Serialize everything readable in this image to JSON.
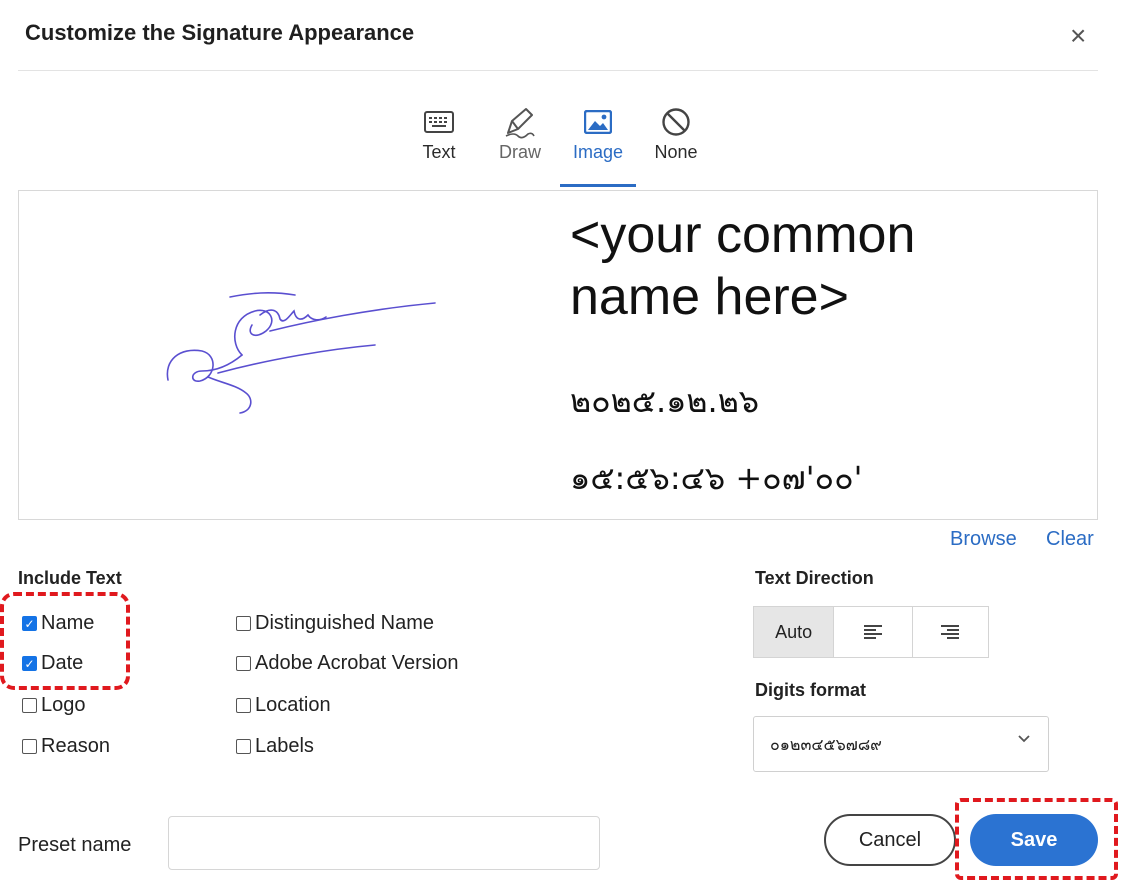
{
  "dialog": {
    "title": "Customize the Signature Appearance",
    "close_symbol": "×"
  },
  "tabs": [
    {
      "label": "Text",
      "icon": "keyboard-icon"
    },
    {
      "label": "Draw",
      "icon": "pen-icon"
    },
    {
      "label": "Image",
      "icon": "image-icon",
      "active": true
    },
    {
      "label": "None",
      "icon": "no-symbol-icon"
    }
  ],
  "preview": {
    "name_line1": "<your common",
    "name_line2": "name here>",
    "date": "๒๐๒๕.๑๒.๒๖",
    "time": "๑๕:๕๖:๔๖ +๐๗'๐๐'"
  },
  "image_actions": {
    "browse": "Browse",
    "clear": "Clear"
  },
  "include_text": {
    "heading": "Include Text",
    "left": [
      {
        "label": "Name",
        "checked": true
      },
      {
        "label": "Date",
        "checked": true
      },
      {
        "label": "Logo",
        "checked": false
      },
      {
        "label": "Reason",
        "checked": false
      }
    ],
    "right": [
      {
        "label": "Distinguished Name",
        "checked": false
      },
      {
        "label": "Adobe Acrobat Version",
        "checked": false
      },
      {
        "label": "Location",
        "checked": false
      },
      {
        "label": "Labels",
        "checked": false
      }
    ]
  },
  "text_direction": {
    "heading": "Text Direction",
    "auto": "Auto",
    "selected": "Auto"
  },
  "digits_format": {
    "heading": "Digits format",
    "value": "๐๑๒๓๔๕๖๗๘๙"
  },
  "preset": {
    "label": "Preset name",
    "value": "",
    "placeholder": ""
  },
  "buttons": {
    "cancel": "Cancel",
    "save": "Save"
  },
  "colors": {
    "accent": "#2b73d2",
    "highlight": "#e0191e",
    "signature_ink": "#5a4fd0"
  }
}
